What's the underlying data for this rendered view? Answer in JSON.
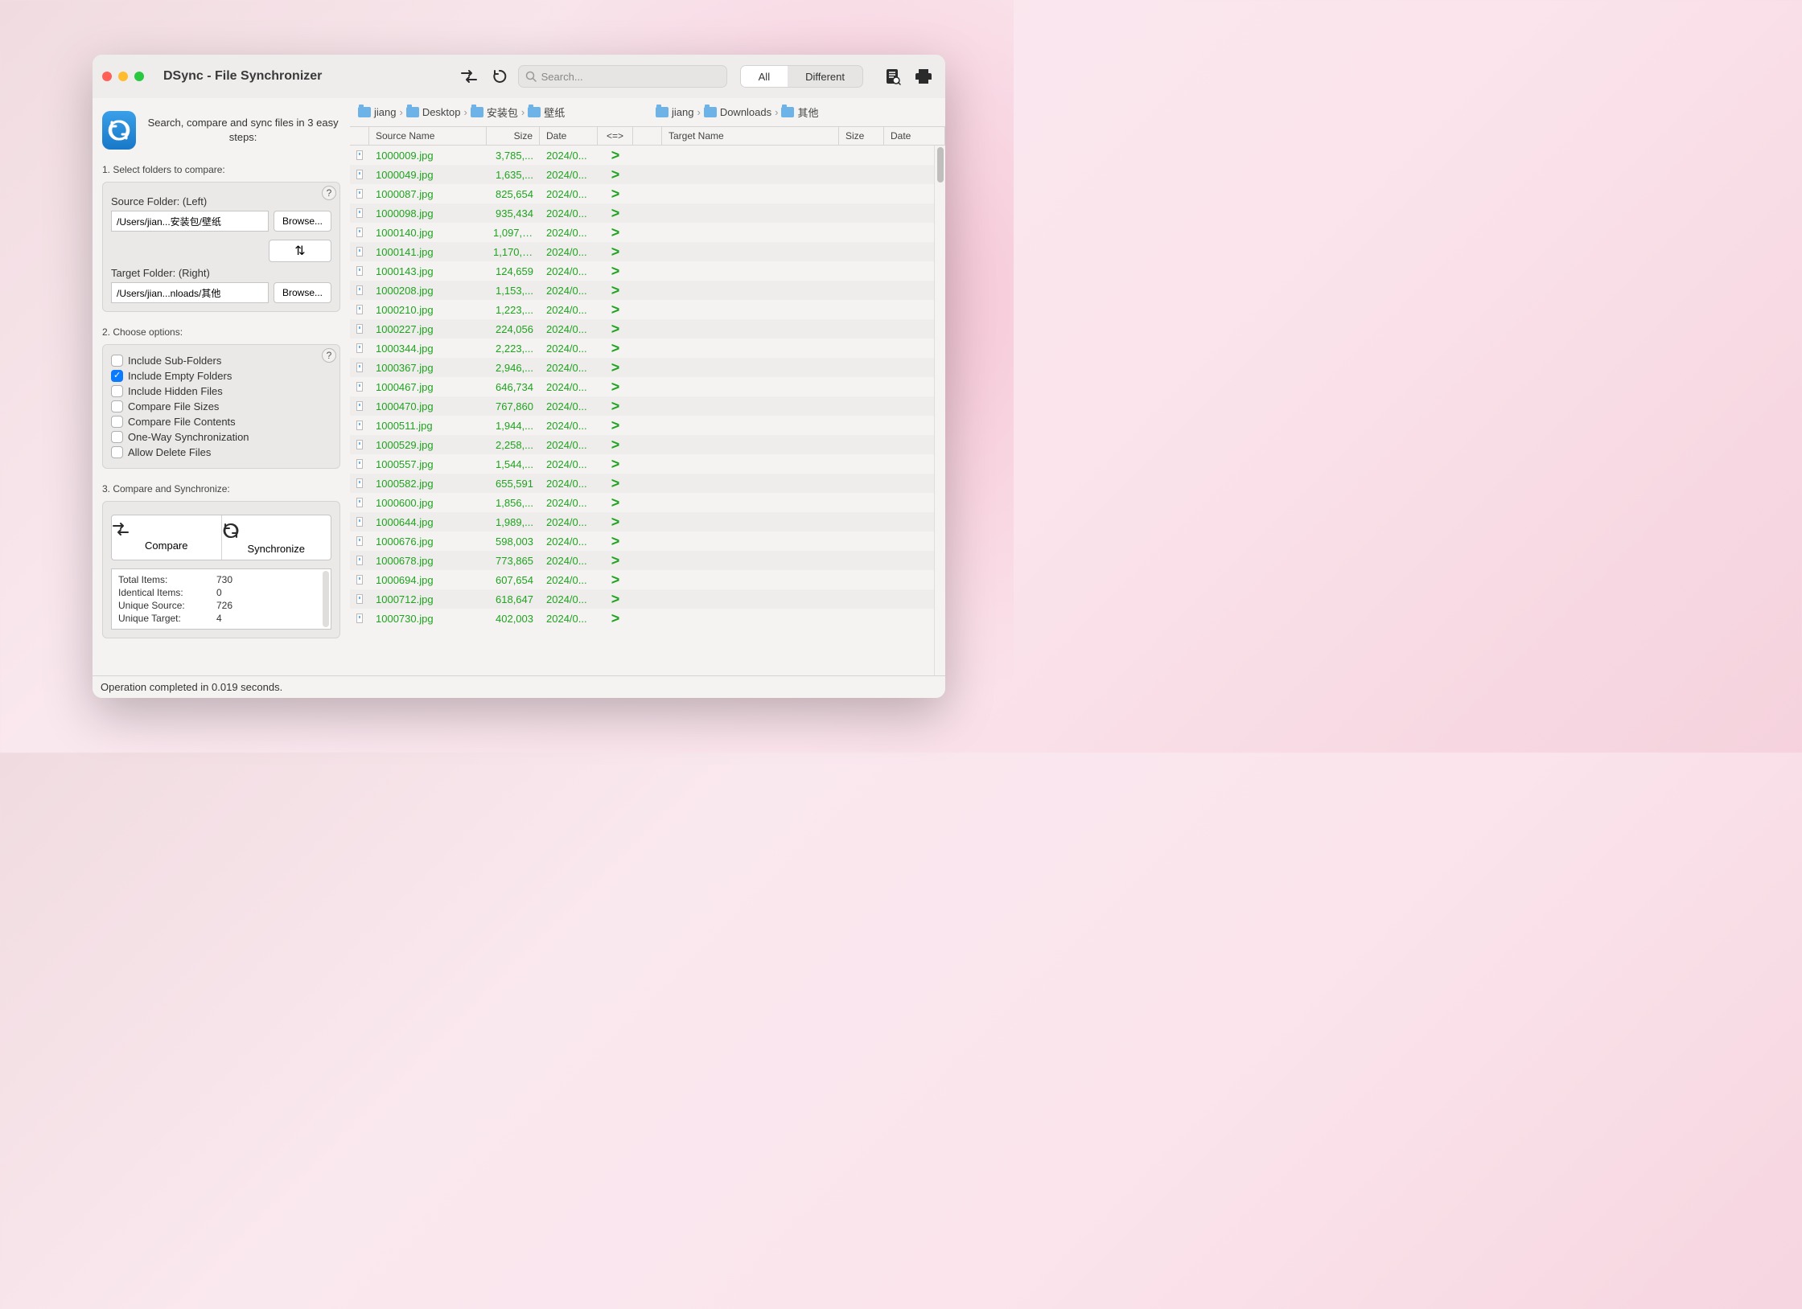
{
  "title": "DSync - File Synchronizer",
  "search_placeholder": "Search...",
  "segment": {
    "all": "All",
    "different": "Different"
  },
  "sidebar": {
    "tagline": "Search, compare and sync files in 3 easy steps:",
    "step1": "1. Select folders to compare:",
    "source_label": "Source Folder: (Left)",
    "source_path": "/Users/jian...安装包/壁纸",
    "target_label": "Target Folder: (Right)",
    "target_path": "/Users/jian...nloads/其他",
    "browse": "Browse...",
    "swap": "⇅",
    "step2": "2. Choose options:",
    "options": [
      {
        "label": "Include Sub-Folders",
        "checked": false
      },
      {
        "label": "Include Empty Folders",
        "checked": true
      },
      {
        "label": "Include Hidden Files",
        "checked": false
      },
      {
        "label": "Compare File Sizes",
        "checked": false
      },
      {
        "label": "Compare File Contents",
        "checked": false
      },
      {
        "label": "One-Way Synchronization",
        "checked": false
      },
      {
        "label": "Allow Delete Files",
        "checked": false
      }
    ],
    "step3": "3. Compare and Synchronize:",
    "compare": "Compare",
    "synchronize": "Synchronize",
    "stats": {
      "total_l": "Total Items:",
      "total_v": "730",
      "ident_l": "Identical Items:",
      "ident_v": "0",
      "usrc_l": "Unique Source:",
      "usrc_v": "726",
      "utgt_l": "Unique Target:",
      "utgt_v": "4"
    }
  },
  "crumbs": {
    "left": [
      "jiang",
      "Desktop",
      "安装包",
      "壁纸"
    ],
    "right": [
      "jiang",
      "Downloads",
      "其他"
    ]
  },
  "headers": {
    "sname": "Source Name",
    "size": "Size",
    "date": "Date",
    "dir": "<=>",
    "tname": "Target Name",
    "tsize": "Size",
    "tdate": "Date"
  },
  "rows": [
    {
      "name": "1000009.jpg",
      "size": "3,785,...",
      "date": "2024/0...",
      "dir": ">"
    },
    {
      "name": "1000049.jpg",
      "size": "1,635,...",
      "date": "2024/0...",
      "dir": ">"
    },
    {
      "name": "1000087.jpg",
      "size": "825,654",
      "date": "2024/0...",
      "dir": ">"
    },
    {
      "name": "1000098.jpg",
      "size": "935,434",
      "date": "2024/0...",
      "dir": ">"
    },
    {
      "name": "1000140.jpg",
      "size": "1,097,1...",
      "date": "2024/0...",
      "dir": ">"
    },
    {
      "name": "1000141.jpg",
      "size": "1,170,4...",
      "date": "2024/0...",
      "dir": ">"
    },
    {
      "name": "1000143.jpg",
      "size": "124,659",
      "date": "2024/0...",
      "dir": ">"
    },
    {
      "name": "1000208.jpg",
      "size": "1,153,...",
      "date": "2024/0...",
      "dir": ">"
    },
    {
      "name": "1000210.jpg",
      "size": "1,223,...",
      "date": "2024/0...",
      "dir": ">"
    },
    {
      "name": "1000227.jpg",
      "size": "224,056",
      "date": "2024/0...",
      "dir": ">"
    },
    {
      "name": "1000344.jpg",
      "size": "2,223,...",
      "date": "2024/0...",
      "dir": ">"
    },
    {
      "name": "1000367.jpg",
      "size": "2,946,...",
      "date": "2024/0...",
      "dir": ">"
    },
    {
      "name": "1000467.jpg",
      "size": "646,734",
      "date": "2024/0...",
      "dir": ">"
    },
    {
      "name": "1000470.jpg",
      "size": "767,860",
      "date": "2024/0...",
      "dir": ">"
    },
    {
      "name": "1000511.jpg",
      "size": "1,944,...",
      "date": "2024/0...",
      "dir": ">"
    },
    {
      "name": "1000529.jpg",
      "size": "2,258,...",
      "date": "2024/0...",
      "dir": ">"
    },
    {
      "name": "1000557.jpg",
      "size": "1,544,...",
      "date": "2024/0...",
      "dir": ">"
    },
    {
      "name": "1000582.jpg",
      "size": "655,591",
      "date": "2024/0...",
      "dir": ">"
    },
    {
      "name": "1000600.jpg",
      "size": "1,856,...",
      "date": "2024/0...",
      "dir": ">"
    },
    {
      "name": "1000644.jpg",
      "size": "1,989,...",
      "date": "2024/0...",
      "dir": ">"
    },
    {
      "name": "1000676.jpg",
      "size": "598,003",
      "date": "2024/0...",
      "dir": ">"
    },
    {
      "name": "1000678.jpg",
      "size": "773,865",
      "date": "2024/0...",
      "dir": ">"
    },
    {
      "name": "1000694.jpg",
      "size": "607,654",
      "date": "2024/0...",
      "dir": ">"
    },
    {
      "name": "1000712.jpg",
      "size": "618,647",
      "date": "2024/0...",
      "dir": ">"
    },
    {
      "name": "1000730.jpg",
      "size": "402,003",
      "date": "2024/0...",
      "dir": ">"
    }
  ],
  "status": "Operation completed in 0.019 seconds."
}
